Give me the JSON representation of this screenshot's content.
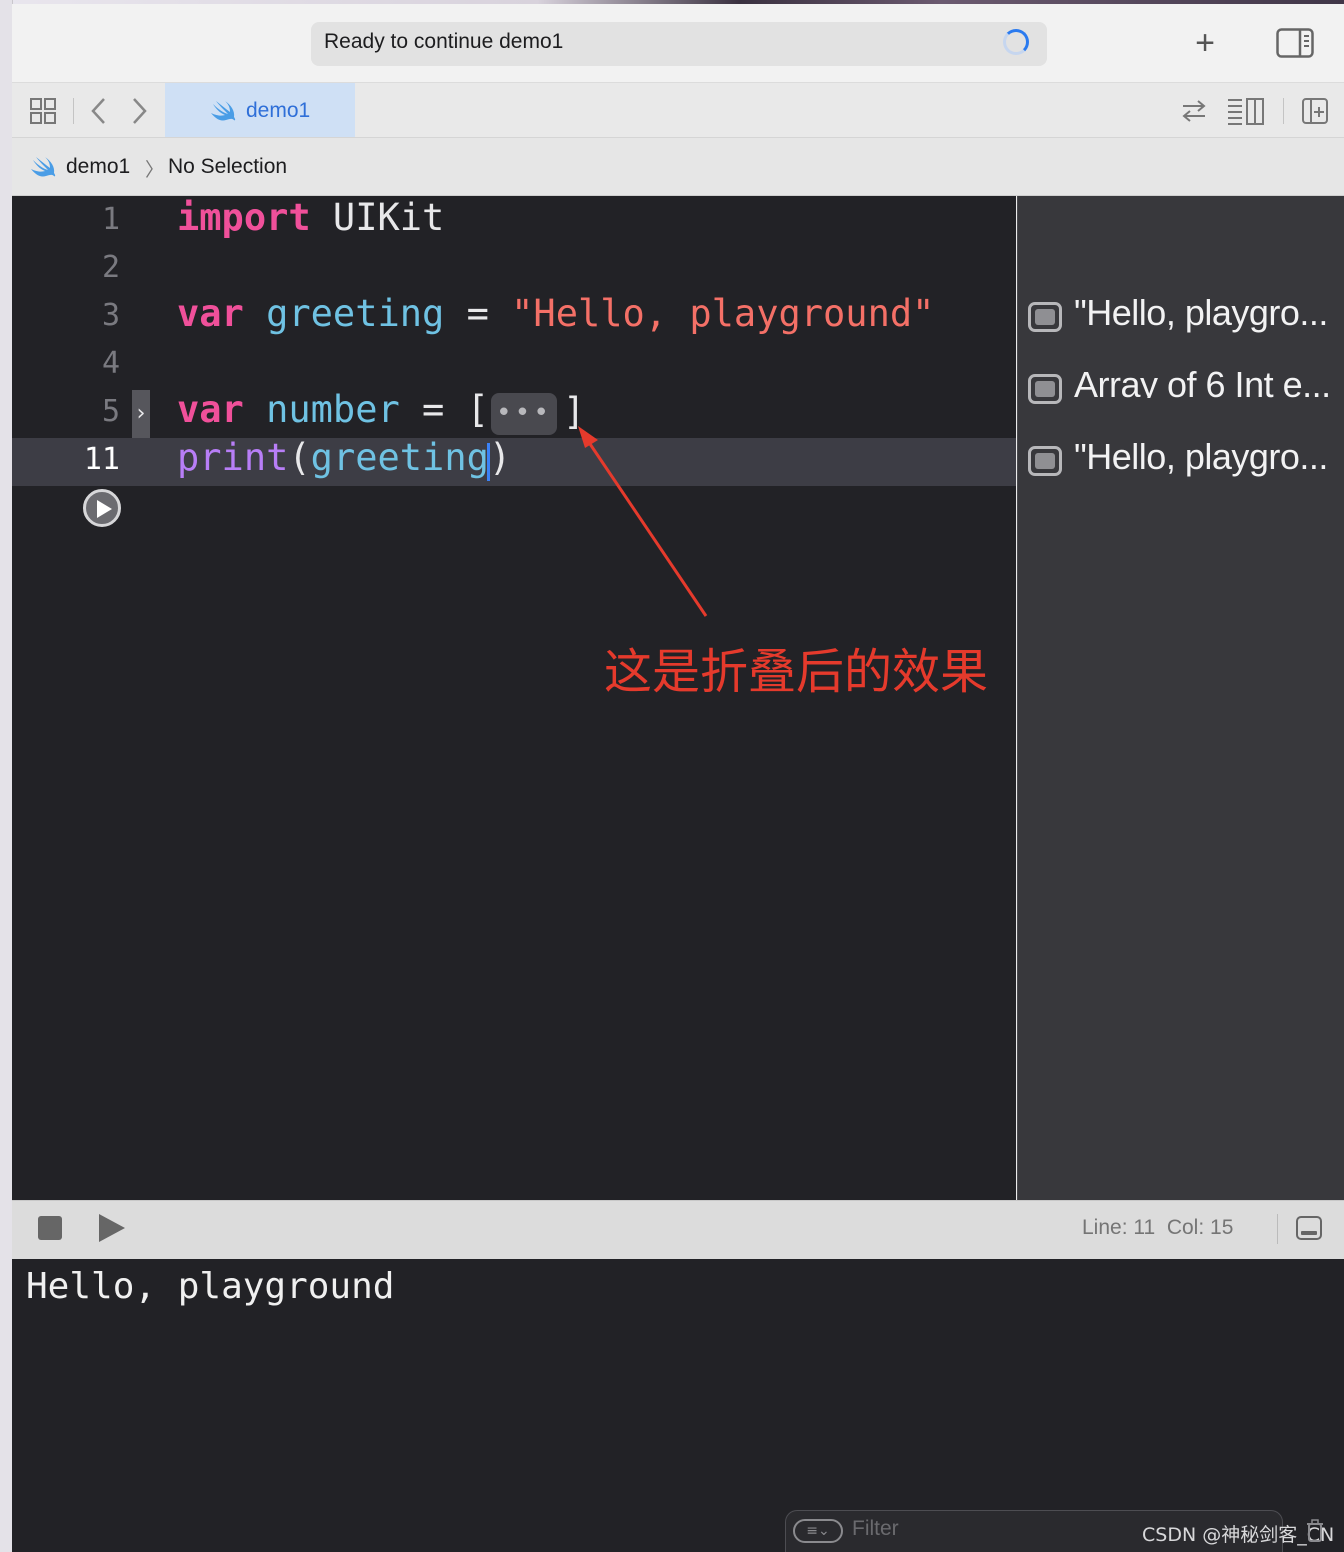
{
  "window": {
    "activity_status": "Ready to continue demo1",
    "add_button": "+"
  },
  "tab": {
    "label": "demo1"
  },
  "jumpbar": {
    "project": "demo1",
    "separator": "〉",
    "selection": "No Selection"
  },
  "editor": {
    "lines": [
      {
        "number": "1",
        "tokens": [
          {
            "text": "import",
            "kind": "kw"
          },
          {
            "text": " UIKit",
            "kind": "plain"
          }
        ]
      },
      {
        "number": "2",
        "tokens": []
      },
      {
        "number": "3",
        "tokens": [
          {
            "text": "var",
            "kind": "kw"
          },
          {
            "text": " ",
            "kind": "plain"
          },
          {
            "text": "greeting",
            "kind": "var"
          },
          {
            "text": " = ",
            "kind": "plain"
          },
          {
            "text": "\"Hello, playground\"",
            "kind": "str"
          }
        ]
      },
      {
        "number": "4",
        "tokens": []
      },
      {
        "number": "5",
        "tokens": [
          {
            "text": "var",
            "kind": "kw"
          },
          {
            "text": " ",
            "kind": "plain"
          },
          {
            "text": "number",
            "kind": "var"
          },
          {
            "text": " = [",
            "kind": "plain"
          }
        ],
        "folded_suffix": "]"
      },
      {
        "number": "11",
        "tokens": [
          {
            "text": "print",
            "kind": "fn"
          },
          {
            "text": "(",
            "kind": "plain"
          },
          {
            "text": "greeting",
            "kind": "var"
          },
          {
            "text": ")",
            "kind": "plain"
          }
        ],
        "current": true
      }
    ],
    "fold_placeholder": "•••",
    "fold_chevron": "›"
  },
  "results": [
    {
      "text": "\"Hello, playgro..."
    },
    {
      "text": "Array of 6 Int e..."
    },
    {
      "text": "\"Hello, playgro..."
    }
  ],
  "annotation": {
    "text": "这是折叠后的效果",
    "color": "#e53a2c"
  },
  "debugbar": {
    "line_col": "Line: 11  Col: 15"
  },
  "console": {
    "output": "Hello, playground",
    "filter_placeholder": "Filter"
  },
  "watermark": "CSDN @神秘剑客_CN",
  "colors": {
    "keyword": "#f0509a",
    "variable": "#6fc2e3",
    "string": "#f47067",
    "function": "#b87ef7",
    "accent": "#2f6fd8"
  }
}
